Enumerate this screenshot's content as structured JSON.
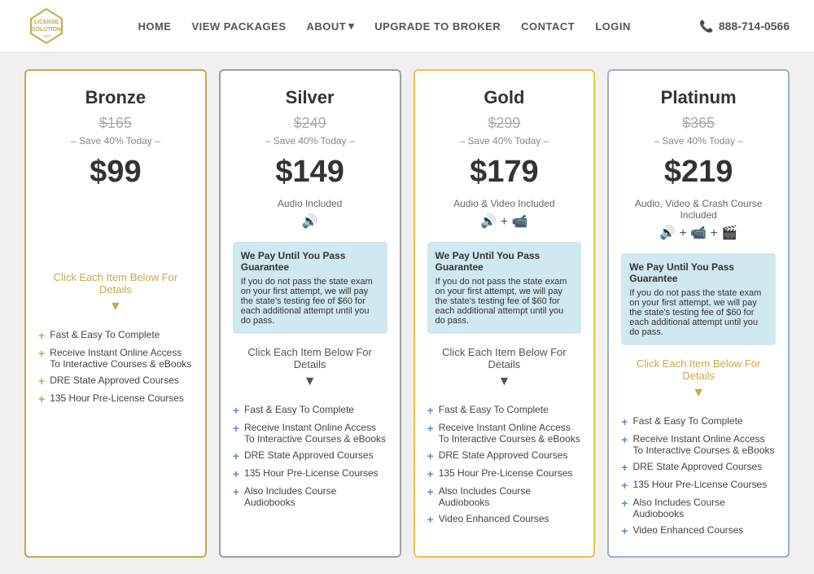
{
  "header": {
    "logo_text": "LICENSE\nSOLUTION",
    "nav_items": [
      {
        "label": "HOME",
        "id": "home"
      },
      {
        "label": "VIEW PACKAGES",
        "id": "view-packages"
      },
      {
        "label": "ABOUT",
        "id": "about"
      },
      {
        "label": "UPGRADE TO BROKER",
        "id": "upgrade"
      },
      {
        "label": "CONTACT",
        "id": "contact"
      },
      {
        "label": "LOGIN",
        "id": "login"
      }
    ],
    "phone": "888-714-0566"
  },
  "cards": [
    {
      "id": "bronze",
      "title": "Bronze",
      "original_price": "$165",
      "save_text": "– Save 40% Today –",
      "price": "$99",
      "includes": null,
      "icons": null,
      "has_guarantee": false,
      "click_text": "Click Each Item Below For Details",
      "features": [
        "Fast & Easy To Complete",
        "Receive Instant Online Access To Interactive Courses & eBooks",
        "DRE State Approved Courses",
        "135 Hour Pre-License Courses"
      ]
    },
    {
      "id": "silver",
      "title": "Silver",
      "original_price": "$249",
      "save_text": "– Save 40% Today –",
      "price": "$149",
      "includes": "Audio Included",
      "icons": "🔊",
      "has_guarantee": true,
      "guarantee_title": "We Pay Until You Pass Guarantee",
      "guarantee_text": "If you do not pass the state exam on your first attempt, we will pay the state's testing fee of $60 for each additional attempt until you do pass.",
      "click_text": "Click Each Item Below For Details",
      "features": [
        "Fast & Easy To Complete",
        "Receive Instant Online Access To Interactive Courses & eBooks",
        "DRE State Approved Courses",
        "135 Hour Pre-License Courses",
        "Also Includes Course Audiobooks"
      ]
    },
    {
      "id": "gold",
      "title": "Gold",
      "original_price": "$299",
      "save_text": "– Save 40% Today –",
      "price": "$179",
      "includes": "Audio & Video Included",
      "icons": "🔊 + 📹",
      "has_guarantee": true,
      "guarantee_title": "We Pay Until You Pass Guarantee",
      "guarantee_text": "If you do not pass the state exam on your first attempt, we will pay the state's testing fee of $60 for each additional attempt until you do pass.",
      "click_text": "Click Each Item Below For Details",
      "features": [
        "Fast & Easy To Complete",
        "Receive Instant Online Access To Interactive Courses & eBooks",
        "DRE State Approved Courses",
        "135 Hour Pre-License Courses",
        "Also Includes Course Audiobooks",
        "Video Enhanced Courses"
      ]
    },
    {
      "id": "platinum",
      "title": "Platinum",
      "original_price": "$365",
      "save_text": "– Save 40% Today –",
      "price": "$219",
      "includes": "Audio, Video & Crash Course Included",
      "icons": "🔊 + 📹 + 🎬",
      "has_guarantee": true,
      "guarantee_title": "We Pay Until You Pass Guarantee",
      "guarantee_text": "If you do not pass the state exam on your first attempt, we will pay the state's testing fee of $60 for each additional attempt until you do pass.",
      "click_text": "Click Each Item Below For Details",
      "features": [
        "Fast & Easy To Complete",
        "Receive Instant Online Access To Interactive Courses & eBooks",
        "DRE State Approved Courses",
        "135 Hour Pre-License Courses",
        "Also Includes Course Audiobooks",
        "Video Enhanced Courses"
      ]
    }
  ]
}
